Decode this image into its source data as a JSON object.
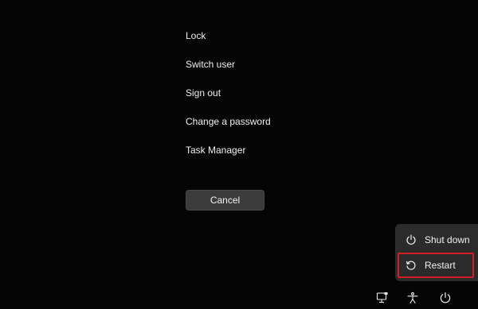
{
  "menu": {
    "items": [
      {
        "label": "Lock"
      },
      {
        "label": "Switch user"
      },
      {
        "label": "Sign out"
      },
      {
        "label": "Change a password"
      },
      {
        "label": "Task Manager"
      }
    ]
  },
  "cancel_label": "Cancel",
  "power_menu": {
    "options": [
      {
        "label": "Shut down",
        "icon": "power-icon"
      },
      {
        "label": "Restart",
        "icon": "restart-icon",
        "highlighted": true
      }
    ]
  },
  "bottom_bar": {
    "icons": [
      "network-icon",
      "accessibility-icon",
      "power-icon"
    ]
  },
  "colors": {
    "background": "#050505",
    "button": "#3b3b3b",
    "flyout": "#2b2b2b",
    "highlight_border": "#d21f2a"
  }
}
